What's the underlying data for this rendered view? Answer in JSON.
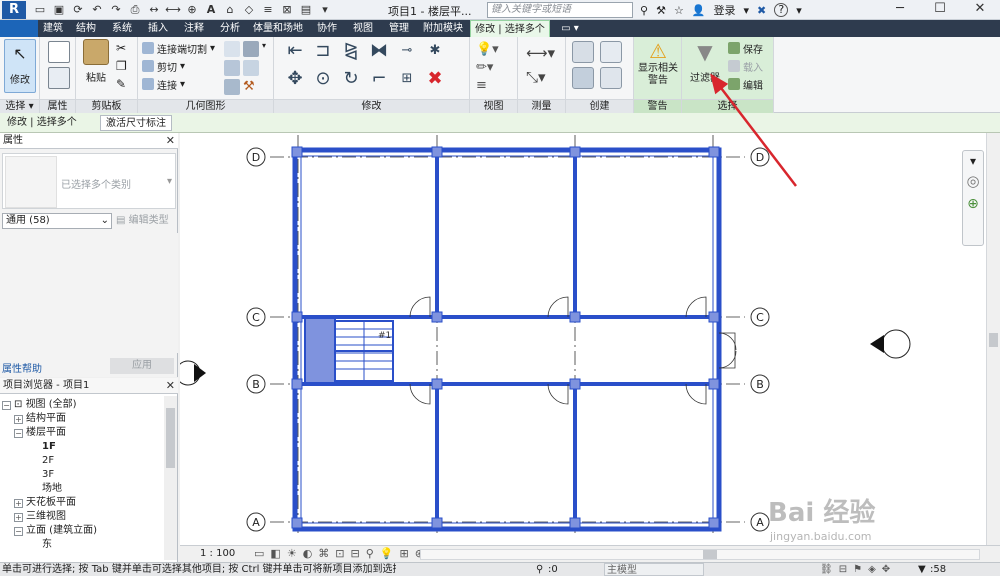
{
  "titlebar": {
    "logo": "R",
    "doc_title": "项目1 - 楼层平...",
    "search_placeholder": "键入关键字或短语",
    "login": "登录",
    "help": "?"
  },
  "tabs": [
    "建筑",
    "结构",
    "系统",
    "插入",
    "注释",
    "分析",
    "体量和场地",
    "协作",
    "视图",
    "管理",
    "附加模块",
    "修改 | 选择多个"
  ],
  "ribbon": {
    "select_modify": "修改",
    "select_panel": "选择",
    "properties_panel": "属性",
    "paste": "粘贴",
    "clipboard_panel": "剪贴板",
    "cut_join": "连接端切割",
    "cut": "剪切",
    "join": "连接",
    "geometry_panel": "几何图形",
    "modify_panel": "修改",
    "view_panel": "视图",
    "measure_panel": "测量",
    "create_panel": "创建",
    "show_warnings": "显示相关警告",
    "warnings_panel": "警告",
    "filter": "过滤器",
    "save": "保存",
    "load": "载入",
    "edit": "编辑",
    "selection_panel": "选择"
  },
  "context_bar": {
    "mode": "修改 | 选择多个",
    "active_dims": "激活尺寸标注"
  },
  "properties": {
    "title": "属性",
    "type_name": "已选择多个类别",
    "filter_value": "通用 (58)",
    "edit_type": "编辑类型",
    "help_link": "属性帮助",
    "apply": "应用"
  },
  "browser": {
    "title": "项目浏览器 - 项目1",
    "items": [
      {
        "label": "视图 (全部)",
        "level": 0,
        "twisty": "-"
      },
      {
        "label": "结构平面",
        "level": 1,
        "twisty": "+"
      },
      {
        "label": "楼层平面",
        "level": 1,
        "twisty": "-"
      },
      {
        "label": "1F",
        "level": 2,
        "twisty": "",
        "bold": true
      },
      {
        "label": "2F",
        "level": 2,
        "twisty": ""
      },
      {
        "label": "3F",
        "level": 2,
        "twisty": ""
      },
      {
        "label": "场地",
        "level": 2,
        "twisty": ""
      },
      {
        "label": "天花板平面",
        "level": 1,
        "twisty": "+"
      },
      {
        "label": "三维视图",
        "level": 1,
        "twisty": "+"
      },
      {
        "label": "立面 (建筑立面)",
        "level": 1,
        "twisty": "-"
      },
      {
        "label": "东",
        "level": 2,
        "twisty": ""
      }
    ]
  },
  "grid_labels": [
    "D",
    "C",
    "B",
    "A"
  ],
  "room_tag": "#1",
  "view_bar": {
    "scale": "1 : 100"
  },
  "status": {
    "message": "单击可进行选择; 按 Tab 键并单击可选择其他项目; 按 Ctrl 键并单击可将新项目添加到选择",
    "count_zero": ":0",
    "model": "主模型",
    "selected_count": ":58"
  },
  "watermark": {
    "brand": "Bai 经验",
    "url": "jingyan.baidu.com"
  },
  "colors": {
    "wall_blue": "#2a4fc9",
    "wall_fill": "#7f93de",
    "annotation_red": "#d8262d",
    "tab_bar": "#2e3b4e",
    "context_green": "#e9f7e9"
  }
}
